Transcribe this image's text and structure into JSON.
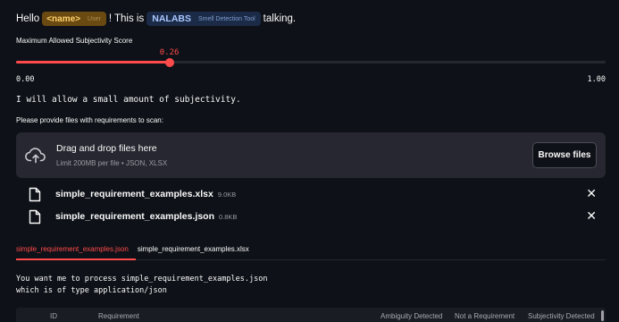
{
  "greeting": {
    "hello": "Hello",
    "name_chip": "<name>",
    "name_chip_sub": "User",
    "this_is": "! This is",
    "tool_chip": "NALABS",
    "tool_chip_sub": "Smell Detection Tool",
    "talking": "talking."
  },
  "slider": {
    "label": "Maximum Allowed Subjectivity Score",
    "value": 0.26,
    "value_text": "0.26",
    "min_text": "0.00",
    "max_text": "1.00",
    "accent_color": "#ff4b4b"
  },
  "subjectivity_message": "I will allow a small amount of subjectivity.",
  "upload": {
    "label": "Please provide files with requirements to scan:",
    "dropzone_title": "Drag and drop files here",
    "dropzone_limit": "Limit 200MB per file • JSON, XLSX",
    "browse_label": "Browse files",
    "icon": "cloud-upload-icon"
  },
  "files": [
    {
      "name": "simple_requirement_examples.xlsx",
      "size": "9.0KB"
    },
    {
      "name": "simple_requirement_examples.json",
      "size": "0.8KB"
    }
  ],
  "close_glyph": "✕",
  "tabs": [
    {
      "label": "simple_requirement_examples.json",
      "active": true
    },
    {
      "label": "simple_requirement_examples.xlsx",
      "active": false
    }
  ],
  "process_message": {
    "line1": "You want me to process simple_requirement_examples.json",
    "line2": "which is of type application/json"
  },
  "table": {
    "columns": [
      "ID",
      "Requirement",
      "Ambiguity Detected",
      "Not a Requirement",
      "Subjectivity Detected"
    ]
  }
}
